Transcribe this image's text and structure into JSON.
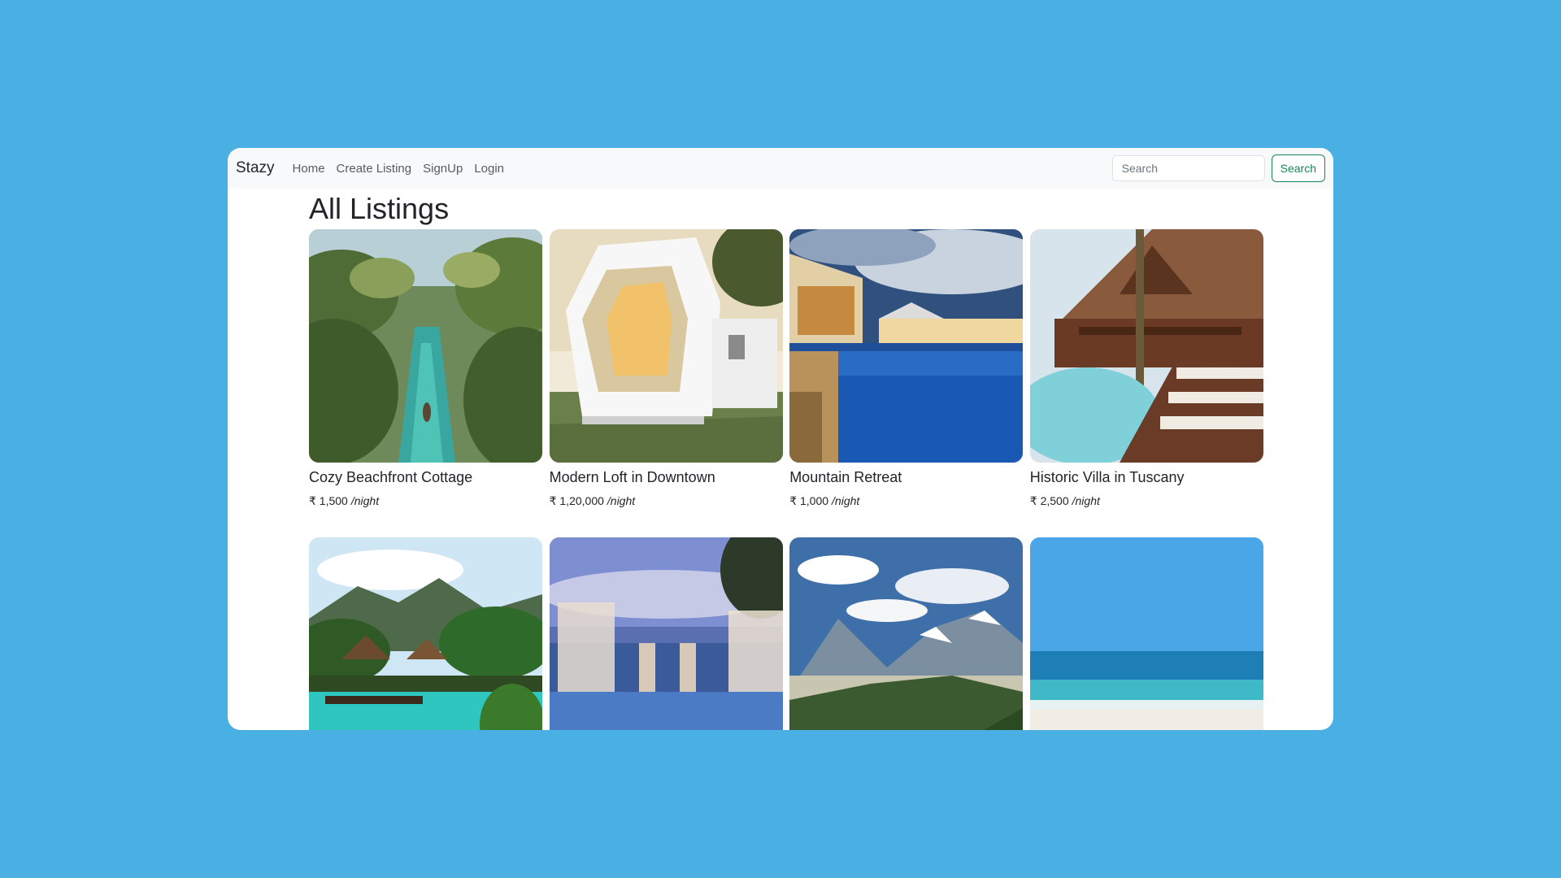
{
  "navbar": {
    "brand": "Stazy",
    "links": [
      "Home",
      "Create Listing",
      "SignUp",
      "Login"
    ],
    "search_placeholder": "Search",
    "search_button": "Search"
  },
  "page": {
    "title": "All Listings"
  },
  "listings": [
    {
      "title": "Cozy Beachfront Cottage",
      "price": "₹ 1,500",
      "per": "/night",
      "image": "tropical-river-palms"
    },
    {
      "title": "Modern Loft in Downtown",
      "price": "₹ 1,20,000",
      "per": "/night",
      "image": "modern-white-house"
    },
    {
      "title": "Mountain Retreat",
      "price": "₹ 1,000",
      "per": "/night",
      "image": "resort-pool-night"
    },
    {
      "title": "Historic Villa in Tuscany",
      "price": "₹ 2,500",
      "per": "/night",
      "image": "wooden-villa-pool"
    },
    {
      "title": "",
      "price": "",
      "per": "",
      "image": "tropical-resort-pool"
    },
    {
      "title": "",
      "price": "",
      "per": "",
      "image": "infinity-pool-cabanas"
    },
    {
      "title": "",
      "price": "",
      "per": "",
      "image": "mountain-valley"
    },
    {
      "title": "",
      "price": "",
      "per": "",
      "image": "tropical-beach"
    }
  ],
  "colors": {
    "background": "#4aafe2",
    "accent": "#198754",
    "navbar": "#f8f9fa"
  }
}
